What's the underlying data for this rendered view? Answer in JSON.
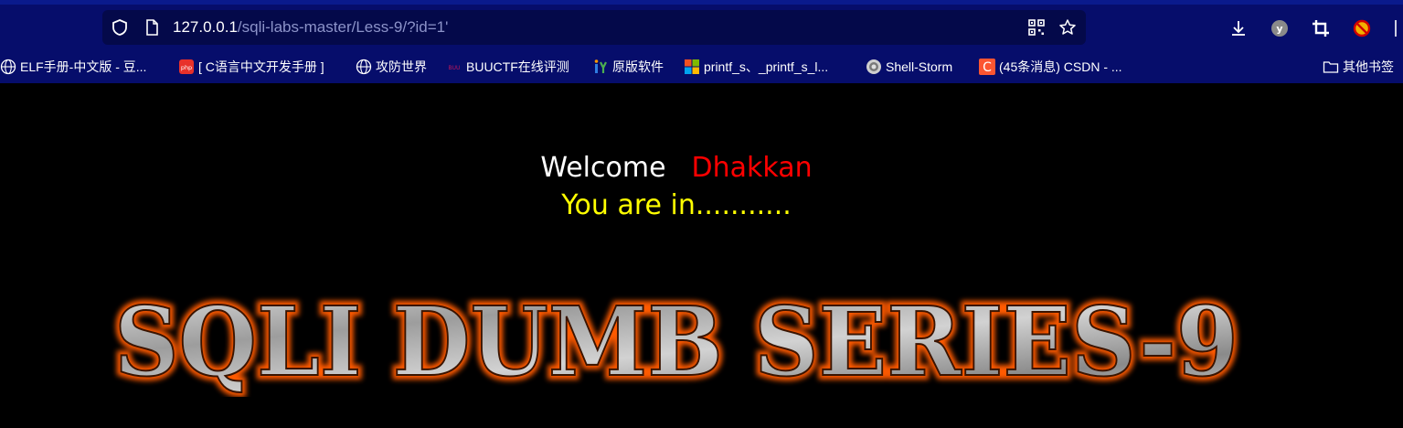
{
  "browser": {
    "url_host": "127.0.0.1",
    "url_path": "/sqli-labs-master/Less-9/?id=1'",
    "icons": {
      "shield": "shield-icon",
      "page": "page-icon",
      "qr": "qr-code-icon",
      "star": "star-icon",
      "download": "download-icon",
      "ext_y": "extension-y-icon",
      "crop": "crop-icon",
      "ext_block": "extension-block-icon"
    }
  },
  "bookmarks": [
    {
      "label": "ELF手册-中文版 - 豆...",
      "icon": "globe-icon"
    },
    {
      "label": "[ C语言中文开发手册 ]",
      "icon": "php-icon"
    },
    {
      "label": "攻防世界",
      "icon": "globe-icon"
    },
    {
      "label": "BUUCTF在线评测",
      "icon": "buuctf-icon"
    },
    {
      "label": "原版软件",
      "icon": "itellyou-icon"
    },
    {
      "label": "printf_s、_printf_s_l...",
      "icon": "windows-icon"
    },
    {
      "label": "Shell-Storm",
      "icon": "shell-storm-icon"
    },
    {
      "label": "(45条消息) CSDN - ...",
      "icon": "csdn-icon"
    },
    {
      "label": "其他书签",
      "icon": "folder-icon"
    }
  ],
  "page": {
    "welcome": "Welcome",
    "name": "Dhakkan",
    "status": "You are in...........",
    "banner": "SQLI DUMB SERIES-9"
  },
  "colors": {
    "chrome": "#060d6b",
    "urlbar": "#04094a",
    "welcome": "#ffffff",
    "name": "#ff0000",
    "status": "#ffff00",
    "banner_glow": "#ff5a00"
  }
}
